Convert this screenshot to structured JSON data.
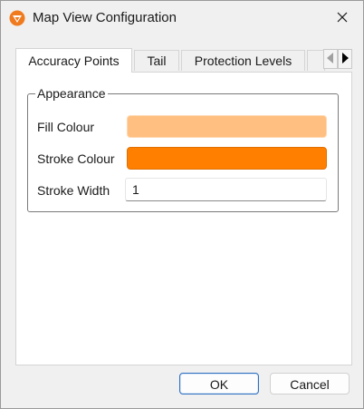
{
  "window": {
    "title": "Map View Configuration",
    "app_icon": "app-logo-icon",
    "close_icon": "close-icon"
  },
  "tabs": [
    {
      "label": "Accuracy Points",
      "active": true
    },
    {
      "label": "Tail",
      "active": false
    },
    {
      "label": "Protection Levels",
      "active": false
    },
    {
      "label": "",
      "active": false
    }
  ],
  "tab_scroll": {
    "left_icon": "chevron-left-icon",
    "right_icon": "chevron-right-icon"
  },
  "appearance": {
    "group_title": "Appearance",
    "fill_colour_label": "Fill Colour",
    "fill_colour_value": "#ffbf80",
    "stroke_colour_label": "Stroke Colour",
    "stroke_colour_value": "#ff8000",
    "stroke_width_label": "Stroke Width",
    "stroke_width_value": "1"
  },
  "buttons": {
    "ok_label": "OK",
    "cancel_label": "Cancel"
  },
  "colors": {
    "accent_border": "#2e6fc0",
    "app_icon_orange": "#f07a1e"
  }
}
